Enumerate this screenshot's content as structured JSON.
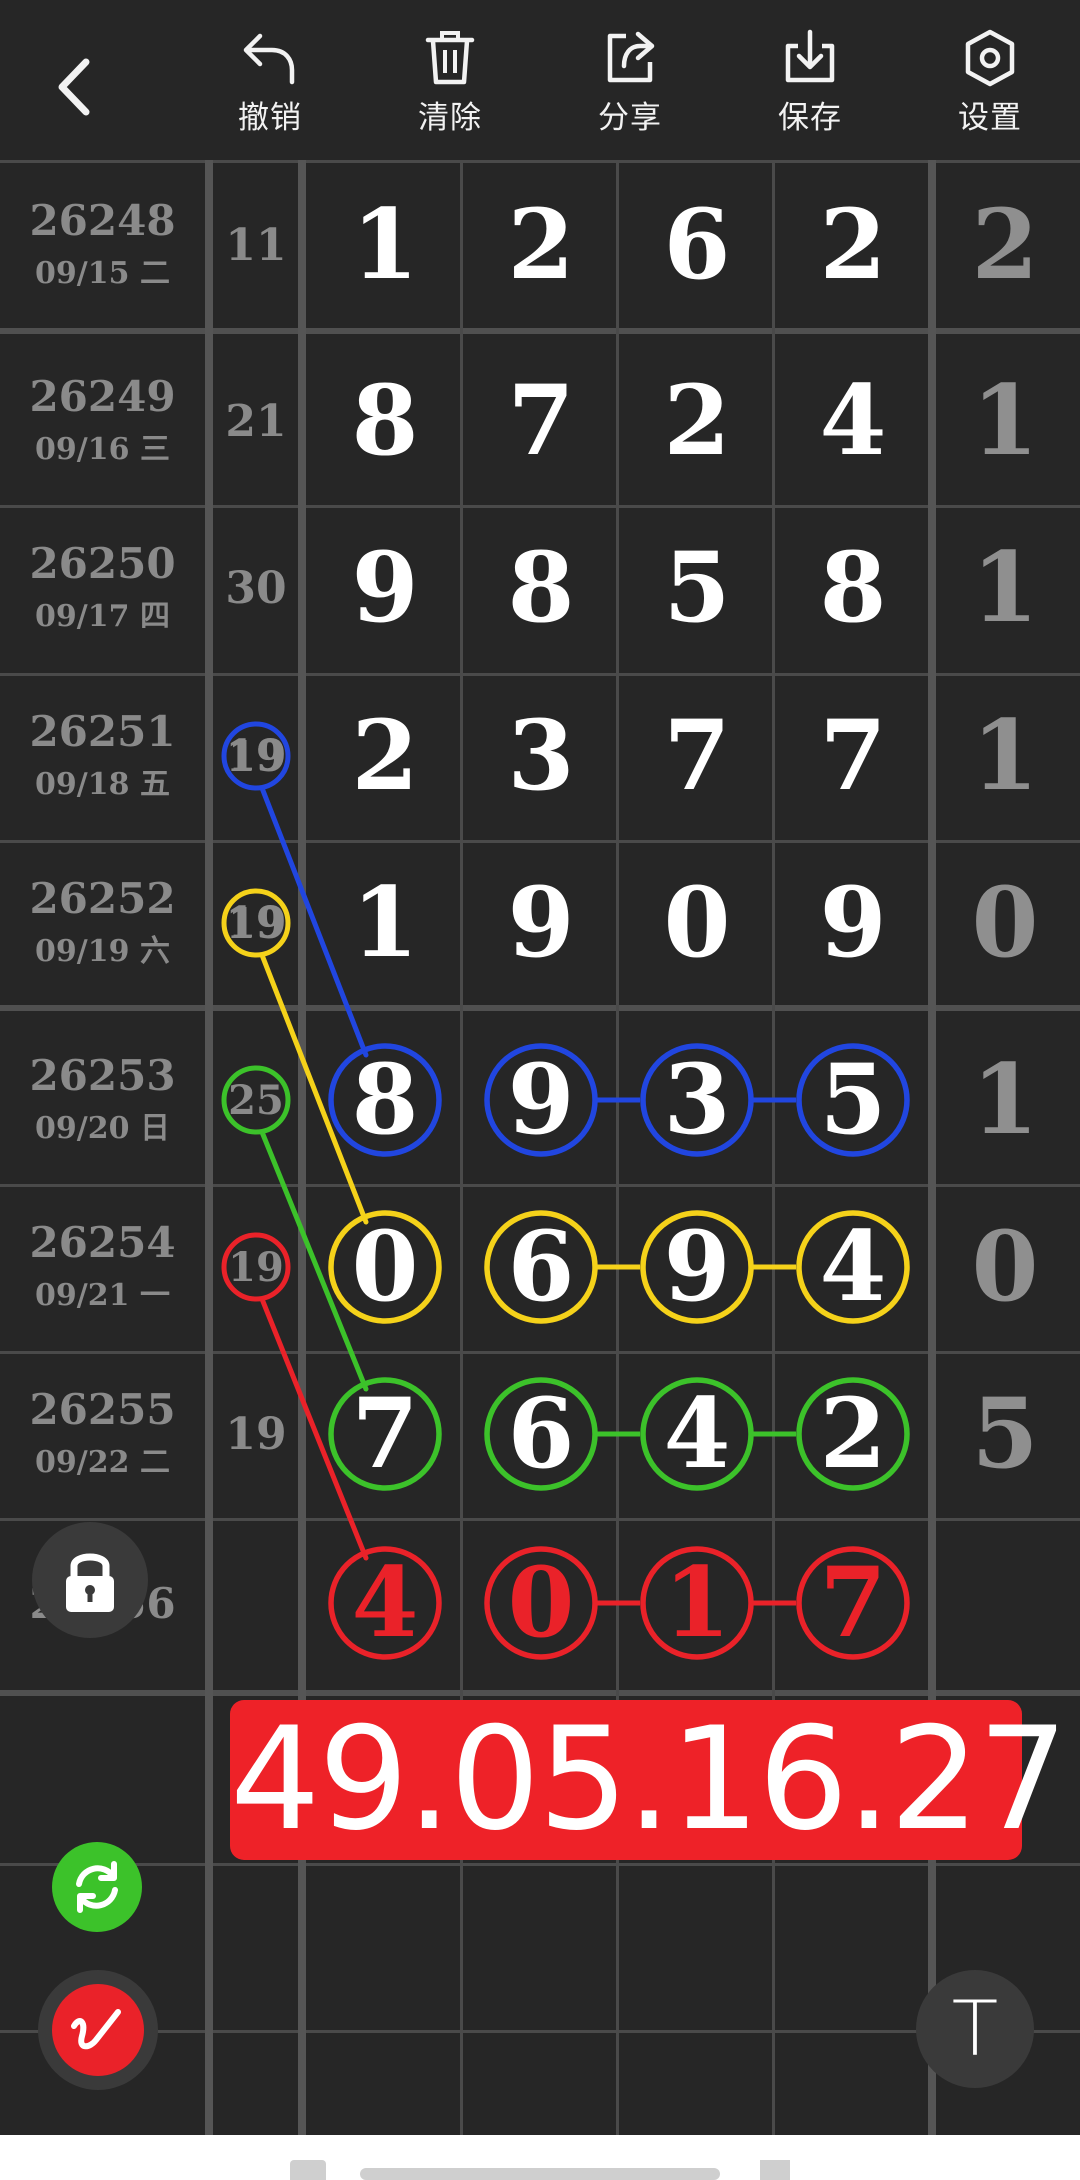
{
  "toolbar": {
    "back_icon": "chevron-left-icon",
    "items": [
      {
        "label": "撤销",
        "icon": "undo-icon"
      },
      {
        "label": "清除",
        "icon": "trash-icon"
      },
      {
        "label": "分享",
        "icon": "share-icon"
      },
      {
        "label": "保存",
        "icon": "download-icon"
      },
      {
        "label": "设置",
        "icon": "hexagon-settings-icon"
      }
    ]
  },
  "rows": [
    {
      "issue": "26248",
      "date": "09/15 二",
      "sum": "11",
      "digits": [
        "1",
        "2",
        "6",
        "2"
      ],
      "last": "2"
    },
    {
      "issue": "26249",
      "date": "09/16 三",
      "sum": "21",
      "digits": [
        "8",
        "7",
        "2",
        "4"
      ],
      "last": "1"
    },
    {
      "issue": "26250",
      "date": "09/17 四",
      "sum": "30",
      "digits": [
        "9",
        "8",
        "5",
        "8"
      ],
      "last": "1"
    },
    {
      "issue": "26251",
      "date": "09/18 五",
      "sum": "19",
      "digits": [
        "2",
        "3",
        "7",
        "7"
      ],
      "last": "1"
    },
    {
      "issue": "26252",
      "date": "09/19 六",
      "sum": "19",
      "digits": [
        "1",
        "9",
        "0",
        "9"
      ],
      "last": "0"
    },
    {
      "issue": "26253",
      "date": "09/20 日",
      "sum": "25",
      "digits": [
        "8",
        "9",
        "3",
        "5"
      ],
      "last": "1"
    },
    {
      "issue": "26254",
      "date": "09/21 一",
      "sum": "19",
      "digits": [
        "0",
        "6",
        "9",
        "4"
      ],
      "last": "0"
    },
    {
      "issue": "26255",
      "date": "09/22 二",
      "sum": "19",
      "digits": [
        "7",
        "6",
        "4",
        "2"
      ],
      "last": "5"
    },
    {
      "issue": "26256",
      "date": "",
      "sum": "",
      "digits": [
        "4",
        "0",
        "1",
        "7"
      ],
      "last": ""
    }
  ],
  "annotation_colors": {
    "blue": "#2146e0",
    "yellow": "#f5d21a",
    "green": "#3cc22a",
    "red": "#ea2229"
  },
  "prediction": {
    "text": "49.05.16.27",
    "background": "#ee2228"
  },
  "floating": {
    "lock_icon": "lock-icon",
    "refresh_icon": "refresh-icon",
    "pen_icon": "pen-icon",
    "text_tool_label": "T"
  }
}
